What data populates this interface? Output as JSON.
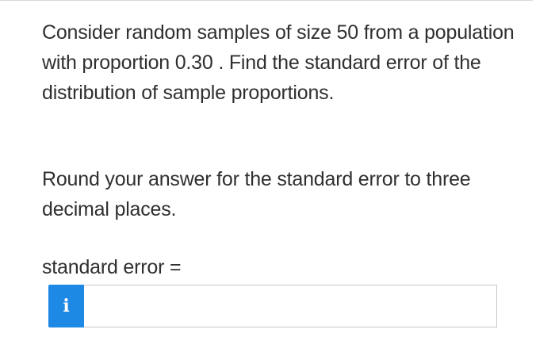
{
  "question": {
    "text": "Consider random samples of size 50 from a population with proportion 0.30 . Find the standard error of the distribution of sample proportions."
  },
  "instruction": {
    "text": "Round your answer for the standard error to three decimal places."
  },
  "answer": {
    "label": "standard error =",
    "info_icon": "info-icon",
    "info_glyph": "i",
    "input_value": "",
    "info_button_color": "#1e88e5"
  }
}
